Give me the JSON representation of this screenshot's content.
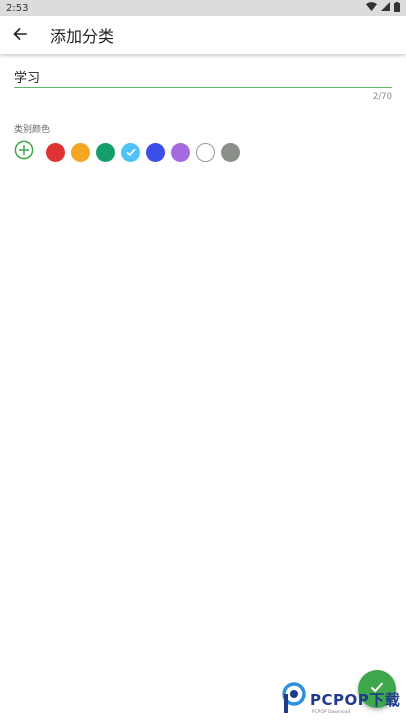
{
  "status_bar": {
    "time": "2:53",
    "icons": [
      "wifi-icon",
      "signal-icon",
      "battery-icon"
    ]
  },
  "app_bar": {
    "back_icon": "arrow-left-icon",
    "title": "添加分类"
  },
  "name_field": {
    "value": "学习",
    "counter": "2/70",
    "underline_color": "#5fb86a"
  },
  "color_section": {
    "label": "类别颜色",
    "add_icon": "plus-circle-icon",
    "swatches": [
      {
        "color": "#e03434",
        "selected": false
      },
      {
        "color": "#f5a623",
        "selected": false
      },
      {
        "color": "#169e6a",
        "selected": false
      },
      {
        "color": "#4fc3f7",
        "selected": true
      },
      {
        "color": "#3c4ee8",
        "selected": false
      },
      {
        "color": "#a66ae0",
        "selected": false
      },
      {
        "color": "#ffffff",
        "selected": false
      },
      {
        "color": "#8a8f8a",
        "selected": false
      }
    ]
  },
  "fab": {
    "icon": "check-icon",
    "color": "#3fa74b"
  },
  "watermark": {
    "brand": "PCPOP下载",
    "sub": "PCPOP Download"
  }
}
